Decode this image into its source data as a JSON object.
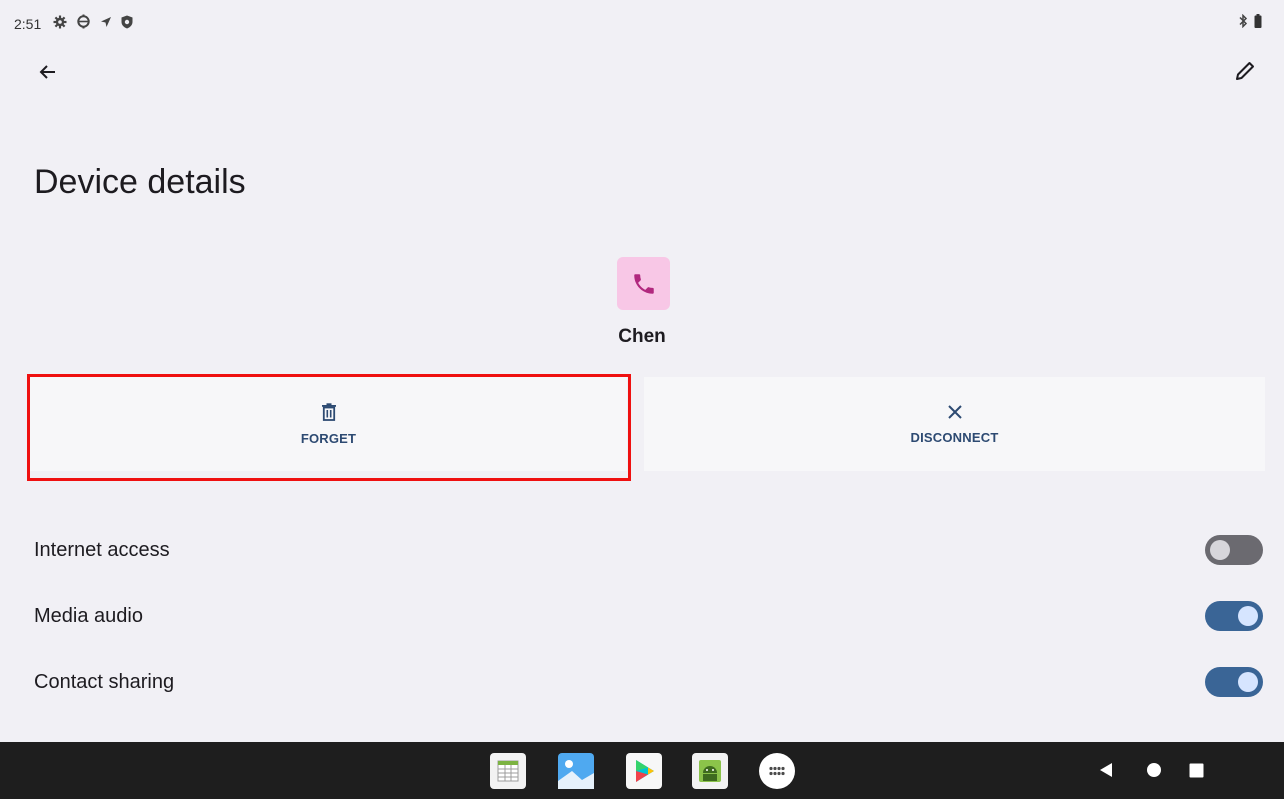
{
  "status_bar": {
    "time": "2:51",
    "left_icons": [
      "settings-gear-icon",
      "debug-gear-icon",
      "location-arrow-icon",
      "shield-icon"
    ],
    "right_icons": [
      "bluetooth-icon",
      "battery-icon"
    ]
  },
  "app_bar": {
    "back_icon": "arrow-back-icon",
    "edit_icon": "pencil-icon"
  },
  "page": {
    "title": "Device details"
  },
  "device": {
    "name": "Chen",
    "icon": "phone-icon",
    "icon_color": "#b1287e",
    "icon_bg": "#f8c7e6"
  },
  "actions": {
    "forget": {
      "label": "FORGET",
      "icon": "trash-icon"
    },
    "disconnect": {
      "label": "DISCONNECT",
      "icon": "close-icon"
    }
  },
  "settings": [
    {
      "label": "Internet access",
      "enabled": false
    },
    {
      "label": "Media audio",
      "enabled": true
    },
    {
      "label": "Contact sharing",
      "enabled": true
    }
  ],
  "dock": {
    "apps": [
      "spreadsheet-app-icon",
      "photos-app-icon",
      "play-store-icon",
      "android-app-icon",
      "app-drawer-icon"
    ]
  },
  "nav": {
    "buttons": [
      "back-triangle-icon",
      "home-circle-icon",
      "recents-square-icon"
    ]
  },
  "colors": {
    "background": "#f1f0f5",
    "accent": "#3a6596",
    "action_text": "#2d4a72",
    "highlight": "#ef1010"
  }
}
